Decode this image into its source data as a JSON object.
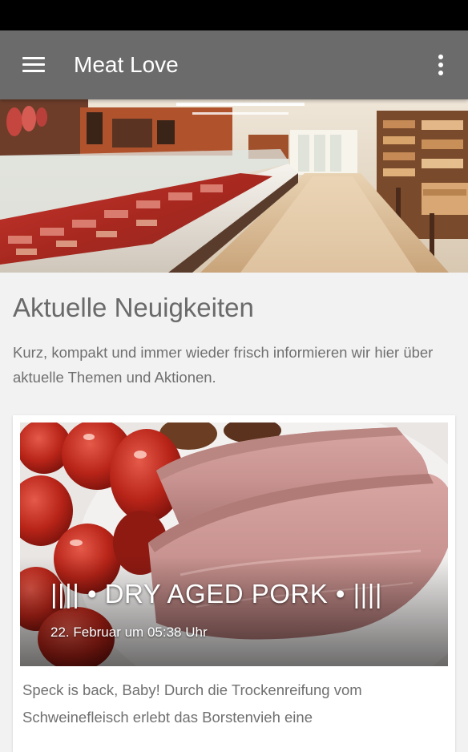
{
  "app_bar": {
    "title": "Meat Love",
    "menu_icon": "hamburger-menu-icon",
    "overflow_icon": "more-vertical-icon",
    "background_color": "#6b6b6b"
  },
  "hero": {
    "image": "butcher-shop-interior"
  },
  "news": {
    "heading": "Aktuelle Neuigkeiten",
    "intro": "Kurz, kompakt und immer wieder frisch informieren wir hier über aktuelle Themen und Aktionen.",
    "items": [
      {
        "title": "|||| • DRY AGED PORK • ||||",
        "date": "22. Februar um 05:38 Uhr",
        "excerpt": "Speck is back, Baby! Durch die Trockenreifung vom Schweinefleisch erlebt das Borstenvieh eine",
        "image": "sliced-pork-with-tomatoes"
      }
    ]
  }
}
